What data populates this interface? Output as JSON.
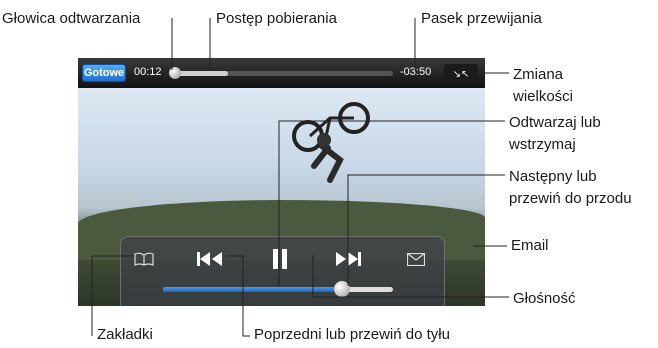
{
  "callouts": {
    "playhead": "Głowica odtwarzania",
    "download_progress": "Postęp pobierania",
    "scrubber_bar": "Pasek przewijania",
    "scale_line1": "Zmiana",
    "scale_line2": "wielkości",
    "play_pause_line1": "Odtwarzaj lub",
    "play_pause_line2": "wstrzymaj",
    "next_line1": "Następny lub",
    "next_line2": "przewiń do przodu",
    "email": "Email",
    "volume": "Głośność",
    "bookmarks": "Zakładki",
    "previous": "Poprzedni lub przewiń do tyłu"
  },
  "player": {
    "done_label": "Gotowe",
    "elapsed": "00:12",
    "remaining": "-03:50",
    "download_fraction": 0.25,
    "volume_fraction": 0.76
  },
  "icons": {
    "scale": "scale-icon",
    "bookmarks": "bookmarks-icon",
    "previous": "previous-icon",
    "play_pause": "pause-icon",
    "next": "next-icon",
    "email": "email-icon"
  },
  "colors": {
    "done_button": "#2b7fdc",
    "volume_fill": "#2f78d8"
  }
}
